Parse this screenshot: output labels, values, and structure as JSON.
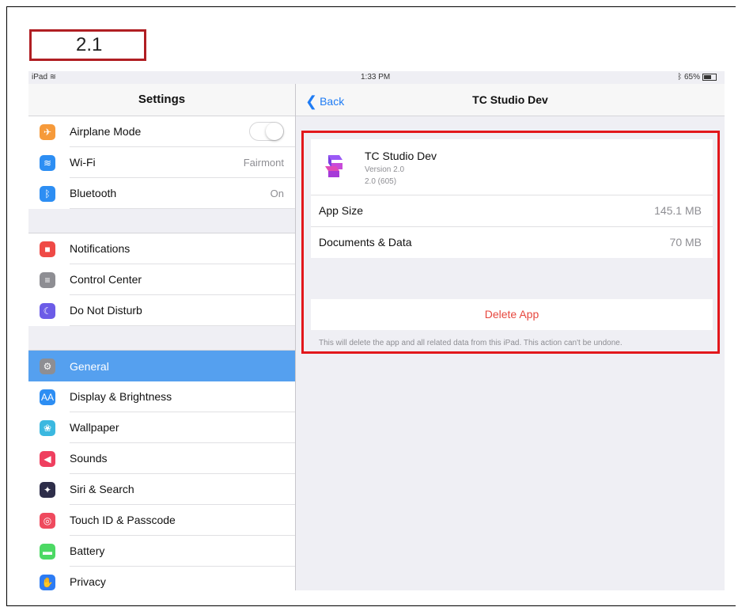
{
  "step_label": "2.1",
  "status_bar": {
    "device": "iPad",
    "time": "1:33 PM",
    "battery": "65%"
  },
  "settings": {
    "title": "Settings",
    "group1": [
      {
        "label": "Airplane Mode",
        "icon": "airplane-icon",
        "color": "#f69a3a",
        "glyph": "✈"
      },
      {
        "label": "Wi-Fi",
        "value": "Fairmont",
        "icon": "wifi-icon",
        "color": "#2d8ef3",
        "glyph": "≋"
      },
      {
        "label": "Bluetooth",
        "value": "On",
        "icon": "bluetooth-icon",
        "color": "#2d8ef3",
        "glyph": "ᛒ"
      }
    ],
    "group2": [
      {
        "label": "Notifications",
        "icon": "notifications-icon",
        "color": "#ef4a46",
        "glyph": "■"
      },
      {
        "label": "Control Center",
        "icon": "control-center-icon",
        "color": "#8e8e93",
        "glyph": "≡"
      },
      {
        "label": "Do Not Disturb",
        "icon": "moon-icon",
        "color": "#6c5ce7",
        "glyph": "☾"
      }
    ],
    "group3": [
      {
        "label": "General",
        "icon": "gear-icon",
        "color": "#8e8e93",
        "glyph": "⚙",
        "selected": true
      },
      {
        "label": "Display & Brightness",
        "icon": "display-icon",
        "color": "#2d8ef3",
        "glyph": "AA"
      },
      {
        "label": "Wallpaper",
        "icon": "wallpaper-icon",
        "color": "#3bb8e0",
        "glyph": "❀"
      },
      {
        "label": "Sounds",
        "icon": "sound-icon",
        "color": "#ef3f5f",
        "glyph": "◀"
      },
      {
        "label": "Siri & Search",
        "icon": "siri-icon",
        "color": "#2e2e4a",
        "glyph": "✦"
      },
      {
        "label": "Touch ID & Passcode",
        "icon": "fingerprint-icon",
        "color": "#ef4a5e",
        "glyph": "◎"
      },
      {
        "label": "Battery",
        "icon": "battery-icon",
        "color": "#4cd964",
        "glyph": "▬"
      },
      {
        "label": "Privacy",
        "icon": "hand-icon",
        "color": "#2d7cf4",
        "glyph": "✋"
      }
    ]
  },
  "detail": {
    "back_label": "Back",
    "title": "TC Studio Dev",
    "app_name": "TC Studio Dev",
    "version": "Version 2.0",
    "build": "2.0 (605)",
    "app_size_label": "App Size",
    "app_size_value": "145.1 MB",
    "docs_label": "Documents & Data",
    "docs_value": "70 MB",
    "delete_label": "Delete App",
    "note": "This will delete the app and all related data from this iPad. This action can't be undone."
  }
}
